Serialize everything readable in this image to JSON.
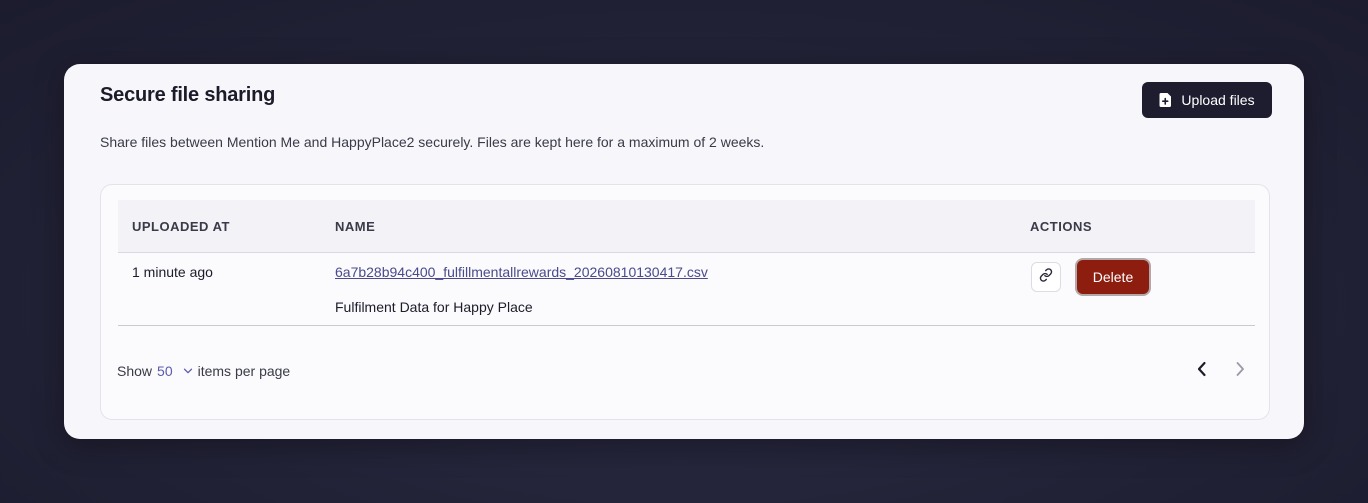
{
  "card": {
    "title": "Secure file sharing",
    "description": "Share files between Mention Me and HappyPlace2 securely. Files are kept here for a maximum of 2 weeks.",
    "upload_button": {
      "label": "Upload files",
      "icon": "file-upload-icon"
    }
  },
  "table": {
    "columns": [
      "UPLOADED AT",
      "NAME",
      "ACTIONS"
    ],
    "rows": [
      {
        "uploaded_at": "1 minute ago",
        "file_name": "6a7b28b94c400_fulfillmentallrewards_20260810130417.csv",
        "file_description": "Fulfilment Data for Happy Place",
        "actions": {
          "copy_link_icon": "link-icon",
          "delete_label": "Delete"
        }
      }
    ]
  },
  "pagination": {
    "show_label": "Show",
    "per_page": "50",
    "items_label": "items per page",
    "prev_icon": "chevron-left-icon",
    "next_icon": "chevron-right-icon"
  },
  "colors": {
    "primary_button": "#1e1d30",
    "danger_button": "#8c1d0f",
    "link": "#4a4a8c",
    "accent": "#5a5ab0"
  }
}
